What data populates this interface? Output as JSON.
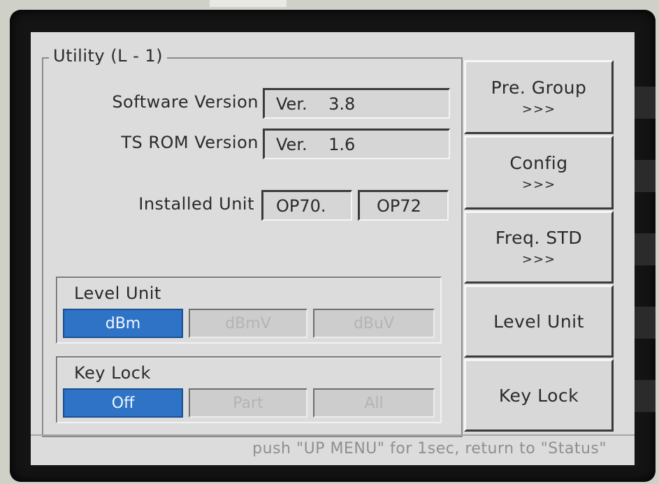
{
  "utility": {
    "title": "Utility  (L - 1)",
    "software_version_label": "Software Version",
    "software_version_value": "Ver.    3.8",
    "ts_rom_version_label": "TS ROM Version",
    "ts_rom_version_value": "Ver.    1.6",
    "installed_unit_label": "Installed Unit",
    "installed_units": [
      "OP70.",
      "OP72"
    ]
  },
  "level_unit": {
    "label": "Level Unit",
    "options": [
      "dBm",
      "dBmV",
      "dBuV"
    ],
    "selected": "dBm"
  },
  "key_lock": {
    "label": "Key Lock",
    "options": [
      "Off",
      "Part",
      "All"
    ],
    "selected": "Off"
  },
  "softkeys": [
    {
      "label": "Pre. Group",
      "arrow": ">>>"
    },
    {
      "label": "Config",
      "arrow": ">>>"
    },
    {
      "label": "Freq. STD",
      "arrow": ">>>"
    },
    {
      "label": "Level Unit",
      "arrow": ""
    },
    {
      "label": "Key Lock",
      "arrow": ""
    }
  ],
  "status": {
    "text": "push \"UP MENU\" for 1sec, return to \"Status\""
  },
  "colors": {
    "selected_option": "#2f73c6",
    "screen_background": "#dcdcdc",
    "bezel": "#141414"
  }
}
